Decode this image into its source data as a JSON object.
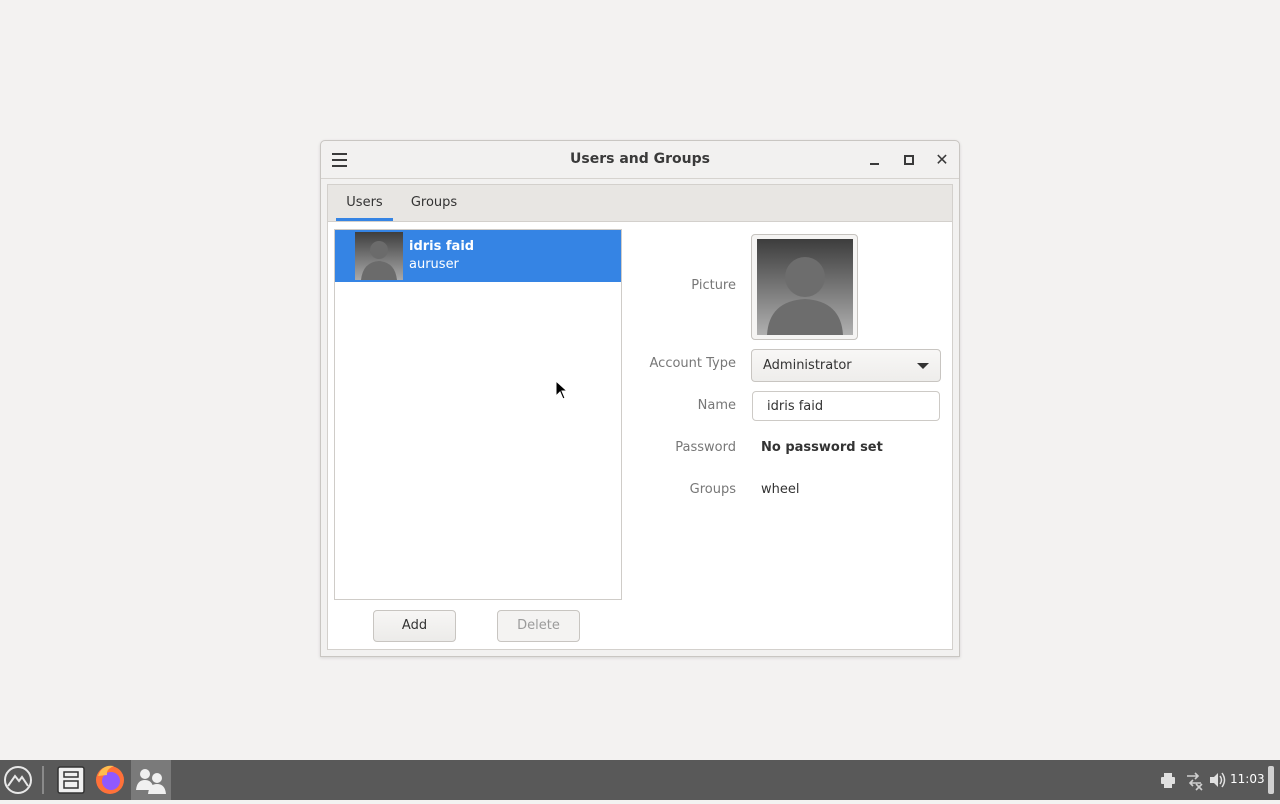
{
  "window": {
    "title": "Users and Groups",
    "close_glyph": "✕"
  },
  "tabs": [
    {
      "label": "Users",
      "active": true
    },
    {
      "label": "Groups",
      "active": false
    }
  ],
  "users": [
    {
      "name": "idris faid",
      "login": "auruser",
      "selected": true
    }
  ],
  "buttons": {
    "add": "Add",
    "delete": "Delete"
  },
  "details": {
    "picture_label": "Picture",
    "account_type_label": "Account Type",
    "account_type_value": "Administrator",
    "name_label": "Name",
    "name_value": "idris faid",
    "password_label": "Password",
    "password_value": "No password set",
    "groups_label": "Groups",
    "groups_value": "wheel"
  },
  "taskbar": {
    "clock": "11:03",
    "apps": [
      "files-icon",
      "firefox-icon",
      "users-icon"
    ],
    "tray_icons": [
      "printer-icon",
      "network-icon",
      "volume-icon"
    ]
  },
  "colors": {
    "accent": "#3584e4",
    "taskbar": "#595959"
  }
}
